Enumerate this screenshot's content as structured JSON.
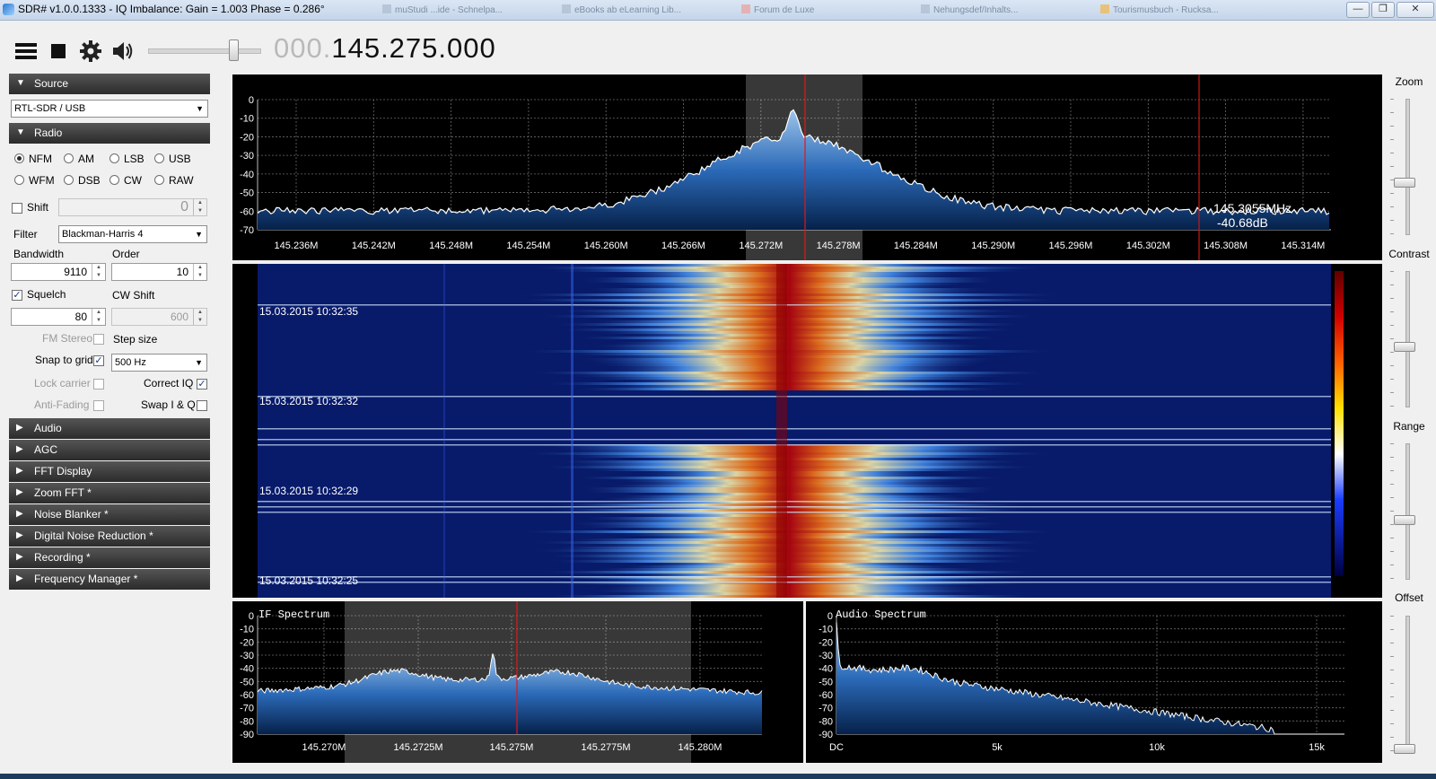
{
  "window": {
    "title": "SDR# v1.0.0.1333 - IQ Imbalance: Gain = 1.003 Phase = 0.286°",
    "buttons": [
      "minimize-icon",
      "restore-icon",
      "close-icon"
    ]
  },
  "background_tabs": [
    {
      "label": "muStudi ...ide - Schnelpa..."
    },
    {
      "label": "eBooks ab eLearning Lib..."
    },
    {
      "label": "Forum de Luxe"
    },
    {
      "label": "Nehungsdef/Inhalts..."
    },
    {
      "label": "Tourismusbuch - Rucksa..."
    }
  ],
  "toolbar": {
    "icons": [
      "menu-icon",
      "stop-icon",
      "settings-icon",
      "speaker-icon"
    ],
    "volume_fraction": 0.75,
    "frequency_dim": "000.",
    "frequency_main": "145.275.000"
  },
  "sidebar": {
    "source": {
      "header": "Source",
      "device": "RTL-SDR / USB"
    },
    "radio": {
      "header": "Radio",
      "modes": [
        {
          "label": "NFM",
          "selected": true
        },
        {
          "label": "AM",
          "selected": false
        },
        {
          "label": "LSB",
          "selected": false
        },
        {
          "label": "USB",
          "selected": false
        },
        {
          "label": "WFM",
          "selected": false
        },
        {
          "label": "DSB",
          "selected": false
        },
        {
          "label": "CW",
          "selected": false
        },
        {
          "label": "RAW",
          "selected": false
        }
      ],
      "shift_label": "Shift",
      "shift_value": "0",
      "filter_label": "Filter",
      "filter_value": "Blackman-Harris 4",
      "bandwidth_label": "Bandwidth",
      "bandwidth_value": "9110",
      "order_label": "Order",
      "order_value": "10",
      "squelch_label": "Squelch",
      "squelch_value": "80",
      "cwshift_label": "CW Shift",
      "cwshift_value": "600",
      "fmstereo_label": "FM Stereo",
      "stepsize_label": "Step size",
      "snap_label": "Snap to grid",
      "step_value": "500 Hz",
      "lockcarrier_label": "Lock carrier",
      "correctiq_label": "Correct IQ",
      "antifading_label": "Anti-Fading",
      "swapiq_label": "Swap I & Q"
    },
    "collapsed_sections": [
      "Audio",
      "AGC",
      "FFT Display",
      "Zoom FFT *",
      "Noise Blanker *",
      "Digital Noise Reduction *",
      "Recording *",
      "Frequency Manager *"
    ]
  },
  "main_spectrum": {
    "y_ticks": [
      "0",
      "-10",
      "-20",
      "-30",
      "-40",
      "-50",
      "-60",
      "-70"
    ],
    "x_ticks": [
      "145.236M",
      "145.242M",
      "145.248M",
      "145.254M",
      "145.260M",
      "145.266M",
      "145.272M",
      "145.278M",
      "145.284M",
      "145.290M",
      "145.296M",
      "145.302M",
      "145.308M",
      "145.314M"
    ],
    "cursor_freq": "145.3055MHz",
    "cursor_level": "-40.68dB"
  },
  "waterfall": {
    "timestamps": [
      "15.03.2015 10:32:35",
      "15.03.2015 10:32:32",
      "15.03.2015 10:32:29",
      "15.03.2015 10:32:25"
    ]
  },
  "if_spectrum": {
    "title": "IF Spectrum",
    "y_ticks": [
      "0",
      "-10",
      "-20",
      "-30",
      "-40",
      "-50",
      "-60",
      "-70",
      "-80",
      "-90"
    ],
    "x_ticks": [
      "145.270M",
      "145.2725M",
      "145.275M",
      "145.2775M",
      "145.280M"
    ]
  },
  "audio_spectrum": {
    "title": "Audio Spectrum",
    "y_ticks": [
      "0",
      "-10",
      "-20",
      "-30",
      "-40",
      "-50",
      "-60",
      "-70",
      "-80",
      "-90"
    ],
    "x_ticks": [
      "DC",
      "5k",
      "10k",
      "15k"
    ]
  },
  "right_controls": {
    "zoom": "Zoom",
    "contrast": "Contrast",
    "range": "Range",
    "offset": "Offset"
  }
}
